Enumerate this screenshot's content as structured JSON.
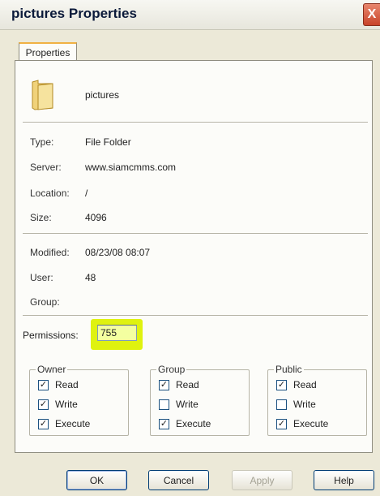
{
  "window": {
    "title": "pictures Properties",
    "close_glyph": "X"
  },
  "tabs": [
    {
      "label": "Properties"
    }
  ],
  "file": {
    "name": "pictures",
    "type_label": "Type:",
    "type_value": "File Folder",
    "server_label": "Server:",
    "server_value": "www.siamcmms.com",
    "location_label": "Location:",
    "location_value": "/",
    "size_label": "Size:",
    "size_value": "4096",
    "modified_label": "Modified:",
    "modified_value": "08/23/08 08:07",
    "user_label": "User:",
    "user_value": "48",
    "group_label": "Group:",
    "group_value": ""
  },
  "permissions": {
    "label": "Permissions:",
    "value": "755",
    "groups": [
      {
        "title": "Owner",
        "read": "Read",
        "write": "Write",
        "execute": "Execute",
        "read_checked": true,
        "write_checked": true,
        "execute_checked": true
      },
      {
        "title": "Group",
        "read": "Read",
        "write": "Write",
        "execute": "Execute",
        "read_checked": true,
        "write_checked": false,
        "execute_checked": true
      },
      {
        "title": "Public",
        "read": "Read",
        "write": "Write",
        "execute": "Execute",
        "read_checked": true,
        "write_checked": false,
        "execute_checked": true
      }
    ]
  },
  "buttons": {
    "ok": "OK",
    "cancel": "Cancel",
    "apply": "Apply",
    "help": "Help"
  },
  "colors": {
    "highlight": "#dff20f",
    "accent_tab": "#f0b143",
    "close": "#c8442a"
  },
  "icons": [
    "folder-icon",
    "close-icon",
    "checkbox-checked",
    "checkbox-unchecked"
  ]
}
